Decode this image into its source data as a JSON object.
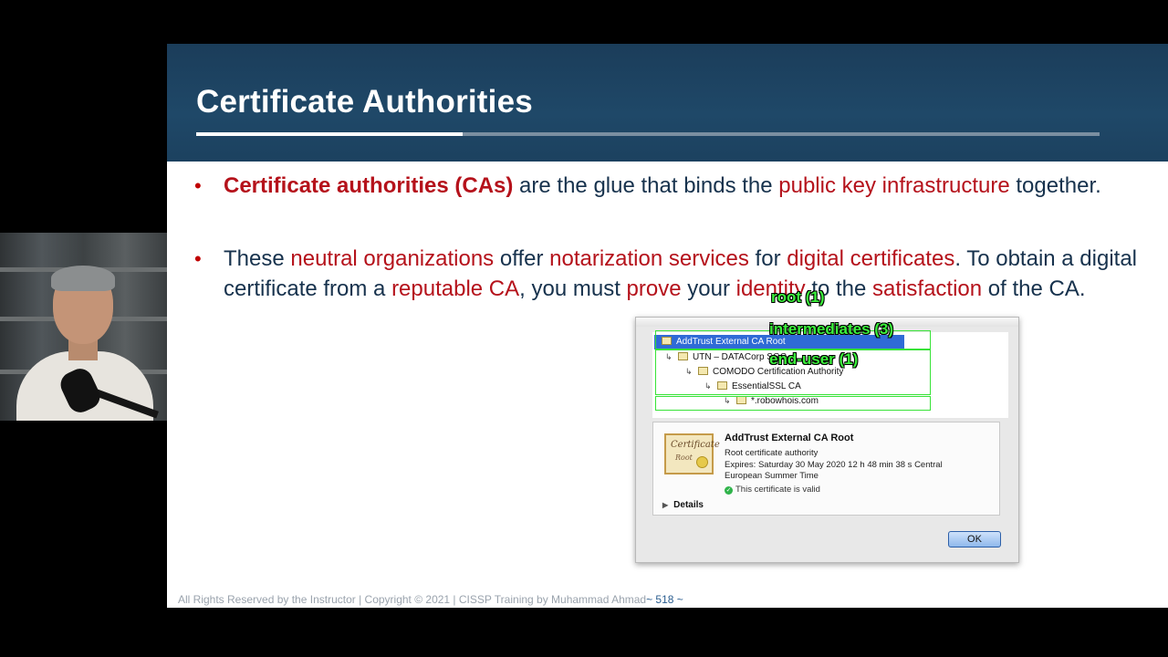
{
  "slide": {
    "title": "Certificate Authorities",
    "bullets": [
      {
        "parts": [
          {
            "text": "Certificate authorities (CAs)",
            "style": "hl-b"
          },
          {
            "text": " are the glue that binds the ",
            "style": ""
          },
          {
            "text": "public key infrastructure",
            "style": "hl"
          },
          {
            "text": " together.",
            "style": ""
          }
        ]
      },
      {
        "parts": [
          {
            "text": "These ",
            "style": ""
          },
          {
            "text": "neutral organizations",
            "style": "hl"
          },
          {
            "text": " offer ",
            "style": ""
          },
          {
            "text": "notarization services",
            "style": "hl"
          },
          {
            "text": " for ",
            "style": ""
          },
          {
            "text": "digital certificates",
            "style": "hl"
          },
          {
            "text": ". To obtain a digital certificate from a ",
            "style": ""
          },
          {
            "text": "reputable CA",
            "style": "hl"
          },
          {
            "text": ", you must ",
            "style": ""
          },
          {
            "text": "prove",
            "style": "hl"
          },
          {
            "text": " your ",
            "style": ""
          },
          {
            "text": "identity",
            "style": "hl"
          },
          {
            "text": " to the ",
            "style": ""
          },
          {
            "text": "satisfaction",
            "style": "hl"
          },
          {
            "text": " of the CA.",
            "style": ""
          }
        ]
      }
    ],
    "footer": "All Rights Reserved by the Instructor | Copyright © 2021 | CISSP Training by Muhammad Ahmad",
    "page_number": "~ 518 ~"
  },
  "dialog": {
    "tree": {
      "root": "AddTrust External CA Root",
      "int1": "UTN – DATACorp SGC",
      "int2": "COMODO Certification Authority",
      "int3": "EssentialSSL CA",
      "user": "*.robowhois.com"
    },
    "info": {
      "title": "AddTrust External CA Root",
      "subtitle": "Root certificate authority",
      "expires": "Expires: Saturday 30 May 2020 12 h 48 min 38 s Central European Summer Time",
      "valid": "This certificate is valid",
      "details": "Details"
    },
    "ok_label": "OK",
    "cert_image_text": "Certificate"
  },
  "annotations": {
    "root": "root (1)",
    "intermediates": "intermediates (3)",
    "end_user": "end-user (1)"
  },
  "colors": {
    "title_bar": "#1f4868",
    "highlight": "#b5121b",
    "body_text": "#17324d",
    "annotation_green": "#3cf23c",
    "selection_blue": "#2f6bd6"
  }
}
